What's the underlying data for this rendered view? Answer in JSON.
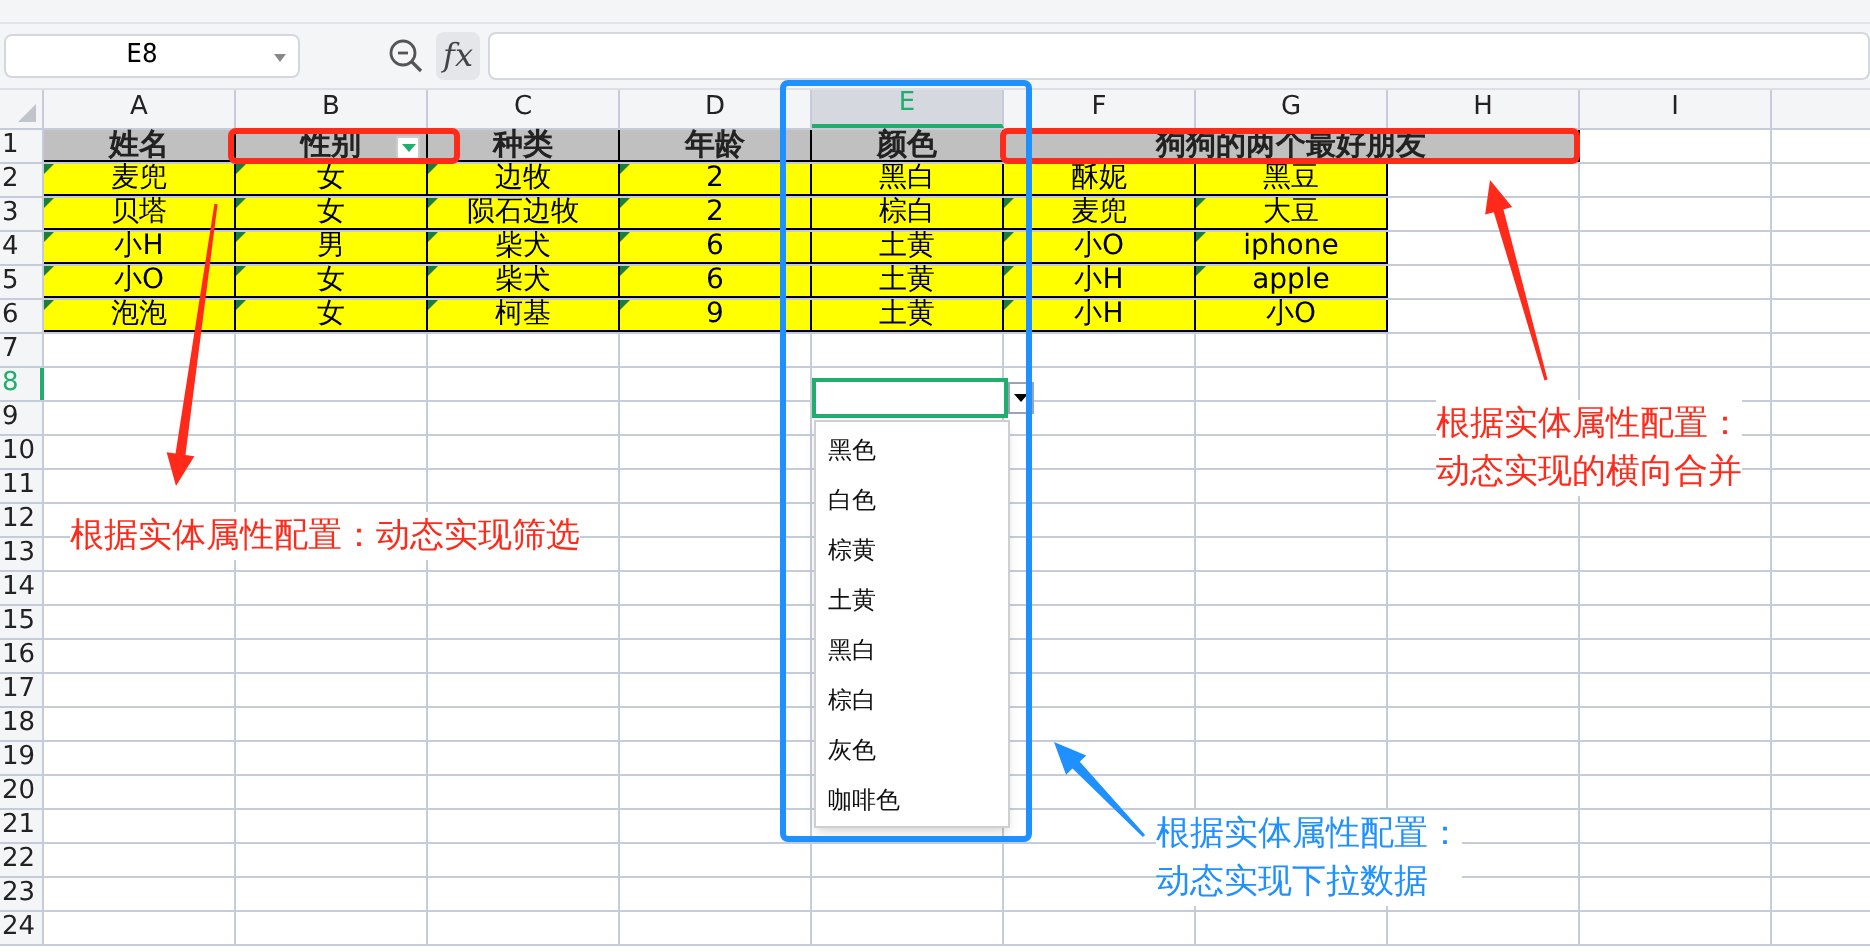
{
  "name_box": {
    "value": "E8"
  },
  "formula_bar": {
    "fx_label": "fx"
  },
  "columns": [
    {
      "label": "A",
      "selected": false
    },
    {
      "label": "B",
      "selected": false
    },
    {
      "label": "C",
      "selected": false
    },
    {
      "label": "D",
      "selected": false
    },
    {
      "label": "E",
      "selected": true
    },
    {
      "label": "F",
      "selected": false
    },
    {
      "label": "G",
      "selected": false
    },
    {
      "label": "H",
      "selected": false
    },
    {
      "label": "I",
      "selected": false
    }
  ],
  "row_numbers": [
    {
      "label": "1",
      "selected": false
    },
    {
      "label": "2",
      "selected": false
    },
    {
      "label": "3",
      "selected": false
    },
    {
      "label": "4",
      "selected": false
    },
    {
      "label": "5",
      "selected": false
    },
    {
      "label": "6",
      "selected": false
    },
    {
      "label": "7",
      "selected": false
    },
    {
      "label": "8",
      "selected": true
    },
    {
      "label": "9",
      "selected": false
    },
    {
      "label": "10",
      "selected": false
    },
    {
      "label": "11",
      "selected": false
    },
    {
      "label": "12",
      "selected": false
    },
    {
      "label": "13",
      "selected": false
    },
    {
      "label": "14",
      "selected": false
    },
    {
      "label": "15",
      "selected": false
    },
    {
      "label": "16",
      "selected": false
    },
    {
      "label": "17",
      "selected": false
    },
    {
      "label": "18",
      "selected": false
    },
    {
      "label": "19",
      "selected": false
    },
    {
      "label": "20",
      "selected": false
    },
    {
      "label": "21",
      "selected": false
    },
    {
      "label": "22",
      "selected": false
    },
    {
      "label": "23",
      "selected": false
    },
    {
      "label": "24",
      "selected": false
    }
  ],
  "header_row": [
    {
      "text": "姓名",
      "filter": false
    },
    {
      "text": "性别",
      "filter": true
    },
    {
      "text": "种类",
      "filter": false
    },
    {
      "text": "年龄",
      "filter": false
    },
    {
      "text": "颜色",
      "filter": false
    }
  ],
  "merged_header": "狗狗的两个最好朋友",
  "data_rows": [
    [
      {
        "text": "麦兜",
        "flagged": true
      },
      {
        "text": "女",
        "flagged": true
      },
      {
        "text": "边牧",
        "flagged": true
      },
      {
        "text": "2",
        "flagged": true
      },
      {
        "text": "黑白",
        "flagged": false
      },
      {
        "text": "酥妮",
        "flagged": false
      },
      {
        "text": "黑豆",
        "flagged": false
      }
    ],
    [
      {
        "text": "贝塔",
        "flagged": true
      },
      {
        "text": "女",
        "flagged": true
      },
      {
        "text": "陨石边牧",
        "flagged": true
      },
      {
        "text": "2",
        "flagged": true
      },
      {
        "text": "棕白",
        "flagged": false
      },
      {
        "text": "麦兜",
        "flagged": true
      },
      {
        "text": "大豆",
        "flagged": true
      }
    ],
    [
      {
        "text": "小H",
        "flagged": true
      },
      {
        "text": "男",
        "flagged": true
      },
      {
        "text": "柴犬",
        "flagged": true
      },
      {
        "text": "6",
        "flagged": true
      },
      {
        "text": "土黄",
        "flagged": false
      },
      {
        "text": "小O",
        "flagged": true
      },
      {
        "text": "iphone",
        "flagged": true
      }
    ],
    [
      {
        "text": "小O",
        "flagged": true
      },
      {
        "text": "女",
        "flagged": true
      },
      {
        "text": "柴犬",
        "flagged": true
      },
      {
        "text": "6",
        "flagged": true
      },
      {
        "text": "土黄",
        "flagged": false
      },
      {
        "text": "小H",
        "flagged": true
      },
      {
        "text": "apple",
        "flagged": true
      }
    ],
    [
      {
        "text": "泡泡",
        "flagged": true
      },
      {
        "text": "女",
        "flagged": true
      },
      {
        "text": "柯基",
        "flagged": true
      },
      {
        "text": "9",
        "flagged": true
      },
      {
        "text": "土黄",
        "flagged": false
      },
      {
        "text": "小H",
        "flagged": true
      },
      {
        "text": "小O",
        "flagged": false
      }
    ]
  ],
  "dropdown": {
    "open": true,
    "items": [
      "黑色",
      "白色",
      "棕黄",
      "土黄",
      "黑白",
      "棕白",
      "灰色",
      "咖啡色"
    ]
  },
  "annotations": [
    {
      "color": "#ff2a1a",
      "lines": [
        "根据实体属性配置：动态实现筛选"
      ]
    },
    {
      "color": "#ff2a1a",
      "lines": [
        "根据实体属性配置：",
        "动态实现的横向合并"
      ]
    },
    {
      "color": "#1e90ff",
      "lines": [
        "根据实体属性配置：",
        "动态实现下拉数据"
      ]
    }
  ]
}
